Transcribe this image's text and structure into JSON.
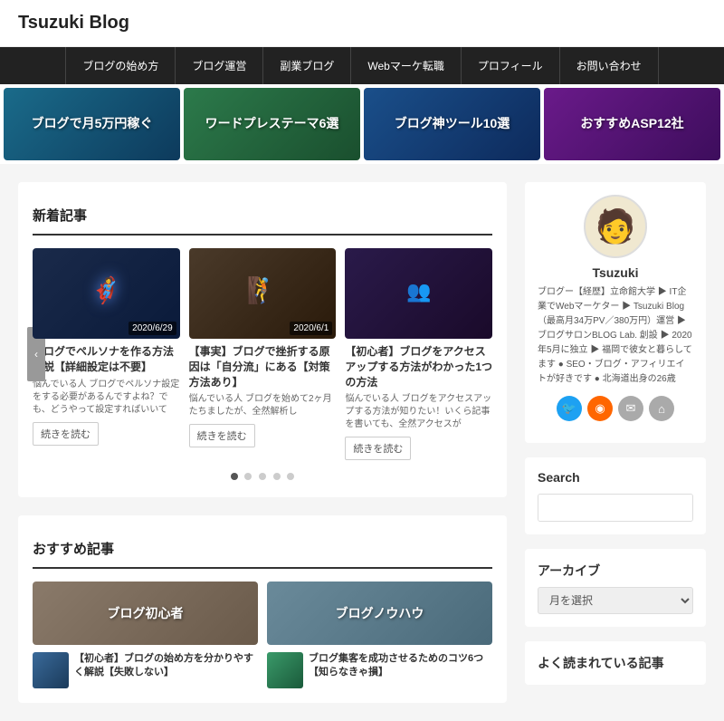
{
  "site": {
    "title": "Tsuzuki Blog"
  },
  "nav": {
    "items": [
      {
        "label": "ブログの始め方",
        "href": "#"
      },
      {
        "label": "ブログ運営",
        "href": "#"
      },
      {
        "label": "副業ブログ",
        "href": "#"
      },
      {
        "label": "Webマーケ転職",
        "href": "#"
      },
      {
        "label": "プロフィール",
        "href": "#"
      },
      {
        "label": "お問い合わせ",
        "href": "#"
      }
    ]
  },
  "hero_banners": [
    {
      "label": "ブログで月5万円稼ぐ"
    },
    {
      "label": "ワードプレステーマ6選"
    },
    {
      "label": "ブログ神ツール10選"
    },
    {
      "label": "おすすめASP12社"
    }
  ],
  "new_posts": {
    "section_title": "新着記事",
    "posts": [
      {
        "date": "2020/6/29",
        "title": "ブログでペルソナを作る方法解説【詳細設定は不要】",
        "excerpt": "悩んでいる人 ブログでペルソナ設定をする必要があるんですよね？でも、どうやって設定すればいいて"
      },
      {
        "date": "2020/6/1",
        "title": "【事実】ブログで挫折する原因は「自分流」にある【対策方法あり】",
        "excerpt": "悩んでいる人 ブログを始めて2ヶ月たちましたが、全然解析し"
      },
      {
        "date": "",
        "title": "【初心者】ブログをアクセスアップする方法がわかった1つの方法",
        "excerpt": "悩んでいる人 ブログをアクセスアップする方法が知りたい！いくら記事を書いても、全然アクセスが"
      }
    ],
    "read_more_label": "続きを読む",
    "pagination_dots": 5
  },
  "recommended": {
    "section_title": "おすすめ記事",
    "categories": [
      {
        "label": "ブログ初心者"
      },
      {
        "label": "ブログノウハウ"
      }
    ],
    "posts": [
      {
        "title": "【初心者】ブログの始め方を分かりやすく解説【失敗しない】"
      },
      {
        "title": "ブログ集客を成功させるためのコツ6つ【知らなきゃ損】"
      }
    ]
  },
  "sidebar": {
    "author": {
      "name": "Tsuzuki",
      "bio": "ブログー【経歴】立命館大学 ▶ IT企業でWebマーケター ▶ Tsuzuki Blog（最高月34万PV／380万円）運営 ▶ ブログサロンBLOG Lab. 創設 ▶ 2020年5月に独立 ▶ 福岡で彼女と暮らしてます ● SEO・ブログ・アフィリエイトが好きです ● 北海道出身の26歳"
    },
    "search": {
      "title": "Search",
      "placeholder": ""
    },
    "archive": {
      "title": "アーカイブ",
      "default_option": "月を選択"
    },
    "popular": {
      "title": "よく読まれている記事"
    },
    "social": [
      {
        "icon": "twitter",
        "label": "Twitter"
      },
      {
        "icon": "rss",
        "label": "RSS"
      },
      {
        "icon": "email",
        "label": "Email"
      },
      {
        "icon": "home",
        "label": "Home"
      }
    ]
  }
}
